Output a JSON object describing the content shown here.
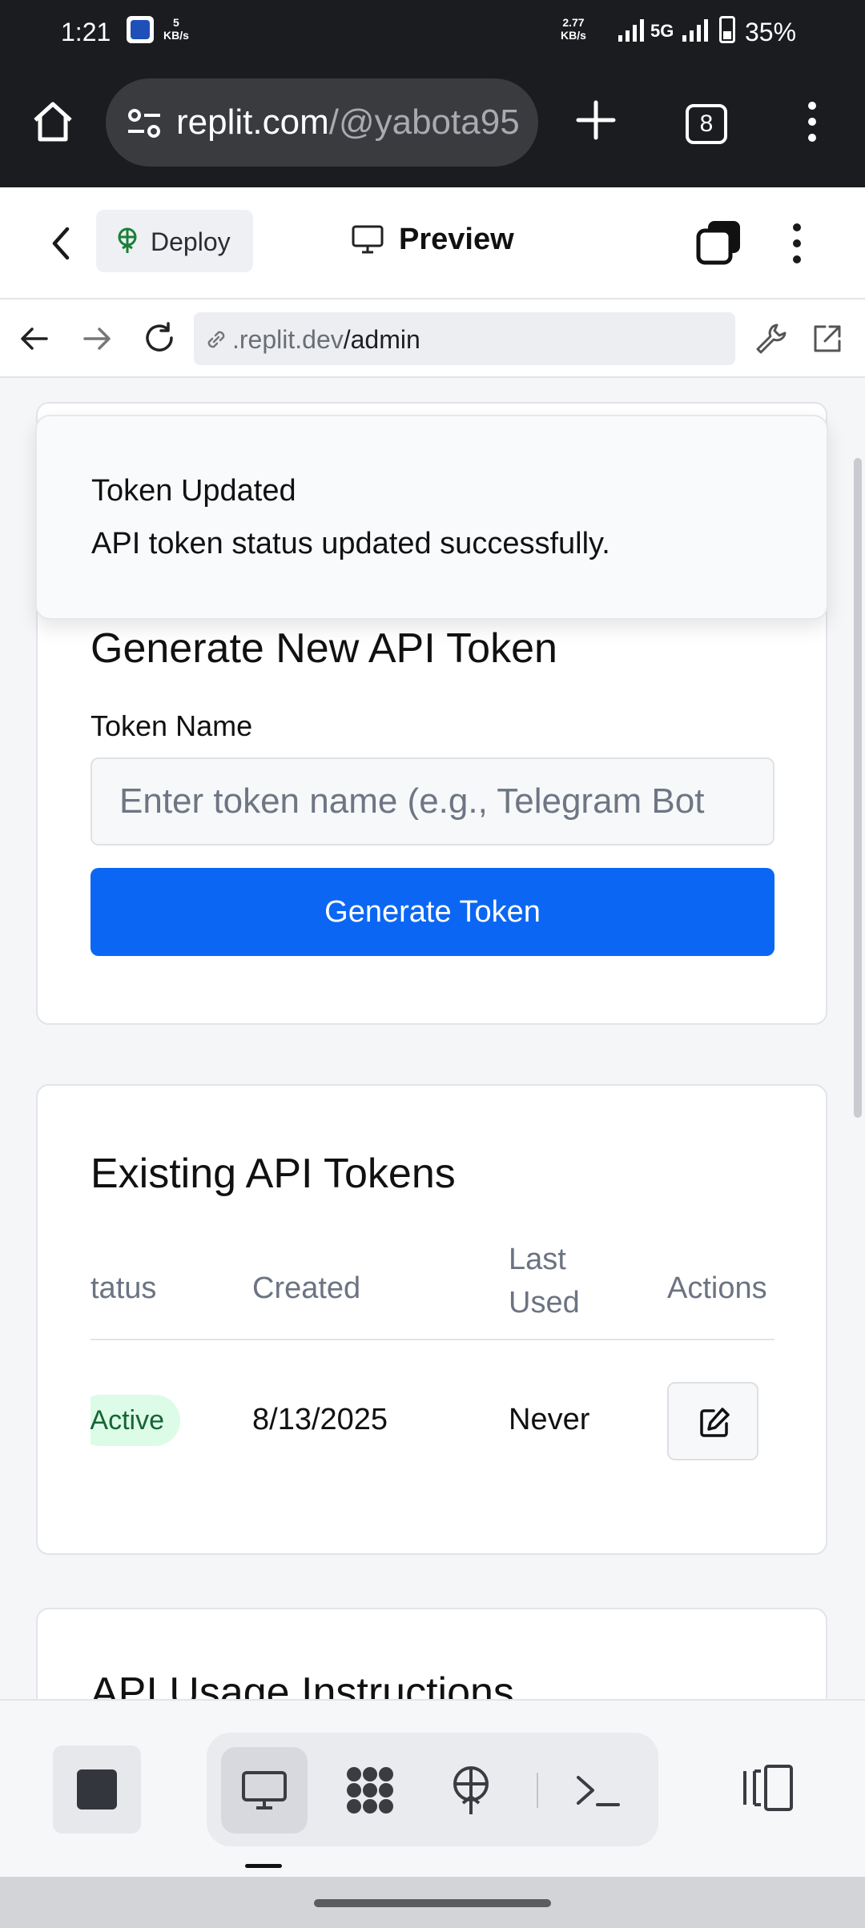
{
  "status_bar": {
    "time": "1:21",
    "net_speed_left_value": "5",
    "net_speed_left_unit": "KB/s",
    "net_speed_right_value": "2.77",
    "net_speed_right_unit": "KB/s",
    "network": "5G",
    "battery": "35%"
  },
  "browser": {
    "url_host": "replit.com",
    "url_path": "/@yabota95",
    "tab_count": "8"
  },
  "replit_header": {
    "deploy_label": "Deploy",
    "preview_label": "Preview"
  },
  "webview": {
    "address_domain": ".replit.dev",
    "address_path": "/admin"
  },
  "toast": {
    "title": "Token Updated",
    "message": "API token status updated successfully."
  },
  "generate_card": {
    "title": "Generate New API Token",
    "field_label": "Token Name",
    "input_placeholder": "Enter token name (e.g., Telegram Bot",
    "input_value": "",
    "button_label": "Generate Token"
  },
  "tokens_card": {
    "title": "Existing API Tokens",
    "columns": [
      "tatus",
      "Created",
      "Last Used",
      "Actions"
    ],
    "rows": [
      {
        "status": "Active",
        "created": "8/13/2025",
        "last_used": "Never"
      }
    ]
  },
  "usage_card": {
    "title": "API Usage Instructions"
  },
  "colors": {
    "primary": "#0b67f3",
    "active_badge_bg": "#dcfce7",
    "active_badge_text": "#166534",
    "chrome_dark": "#1b1c1f"
  },
  "icons": [
    "home-icon",
    "site-settings-icon",
    "plus-icon",
    "tabs-icon",
    "overflow-menu-icon",
    "chevron-left-icon",
    "deploy-icon",
    "monitor-icon",
    "stack-icon",
    "arrow-left-icon",
    "arrow-right-icon",
    "reload-icon",
    "link-icon",
    "wrench-icon",
    "external-link-icon",
    "edit-icon",
    "stop-icon",
    "preview-tool-icon",
    "apps-icon",
    "deployments-icon",
    "terminal-icon",
    "sidebar-toggle-icon"
  ]
}
